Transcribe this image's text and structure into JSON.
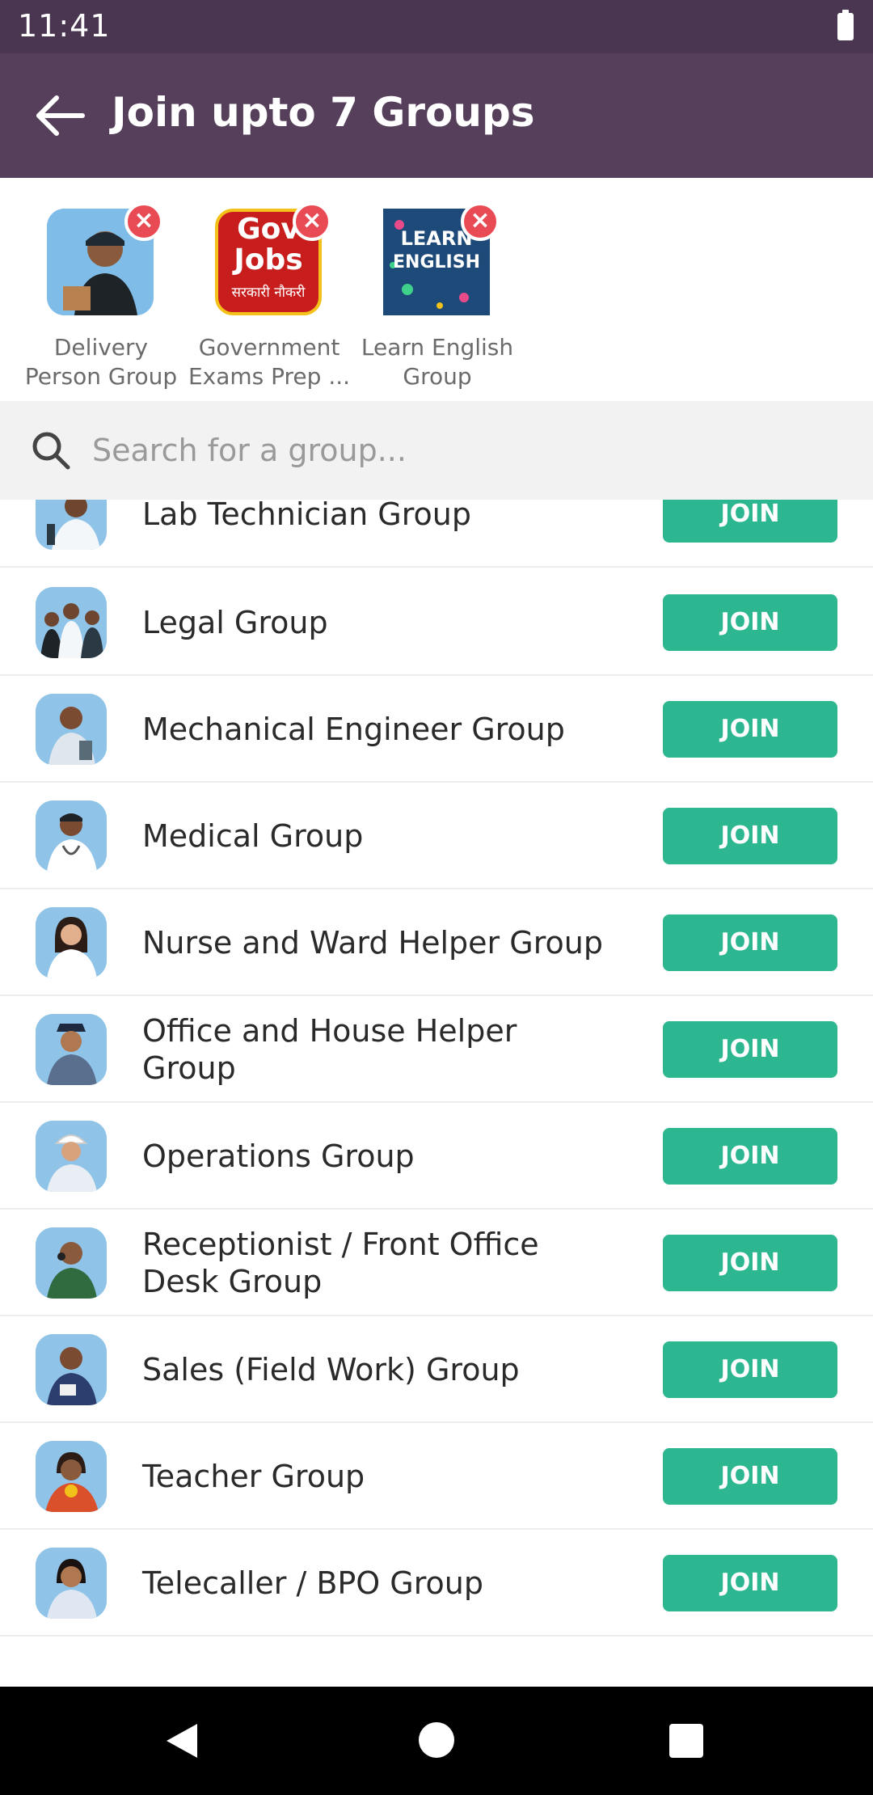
{
  "status_bar": {
    "time": "11:41"
  },
  "app_bar": {
    "title": "Join upto 7 Groups"
  },
  "selected_groups": [
    {
      "label": "Delivery Person Group",
      "thumb_icon": "delivery-person-photo"
    },
    {
      "label": "Government Exams Prep ...",
      "thumb_icon": "gov-jobs-banner",
      "thumb_text_line1": "Gov",
      "thumb_text_line2": "Jobs",
      "thumb_text_line3": "सरकारी नौकरी"
    },
    {
      "label": "Learn English Group",
      "thumb_icon": "learn-english-banner",
      "thumb_text_line1": "LEARN",
      "thumb_text_line2": "ENGLISH"
    }
  ],
  "search": {
    "placeholder": "Search for a group..."
  },
  "join_label": "JOIN",
  "groups": [
    {
      "name": "Lab Technician Group"
    },
    {
      "name": "Legal Group"
    },
    {
      "name": "Mechanical Engineer Group"
    },
    {
      "name": "Medical Group"
    },
    {
      "name": "Nurse and Ward Helper Group"
    },
    {
      "name": "Office and House Helper Group"
    },
    {
      "name": "Operations Group"
    },
    {
      "name": "Receptionist / Front Office Desk Group"
    },
    {
      "name": "Sales (Field Work) Group"
    },
    {
      "name": "Teacher Group"
    },
    {
      "name": "Telecaller / BPO Group"
    }
  ],
  "colors": {
    "status_bar": "#4a3650",
    "app_bar": "#553f5a",
    "join_button": "#2db791",
    "remove_badge": "#e94b55"
  }
}
